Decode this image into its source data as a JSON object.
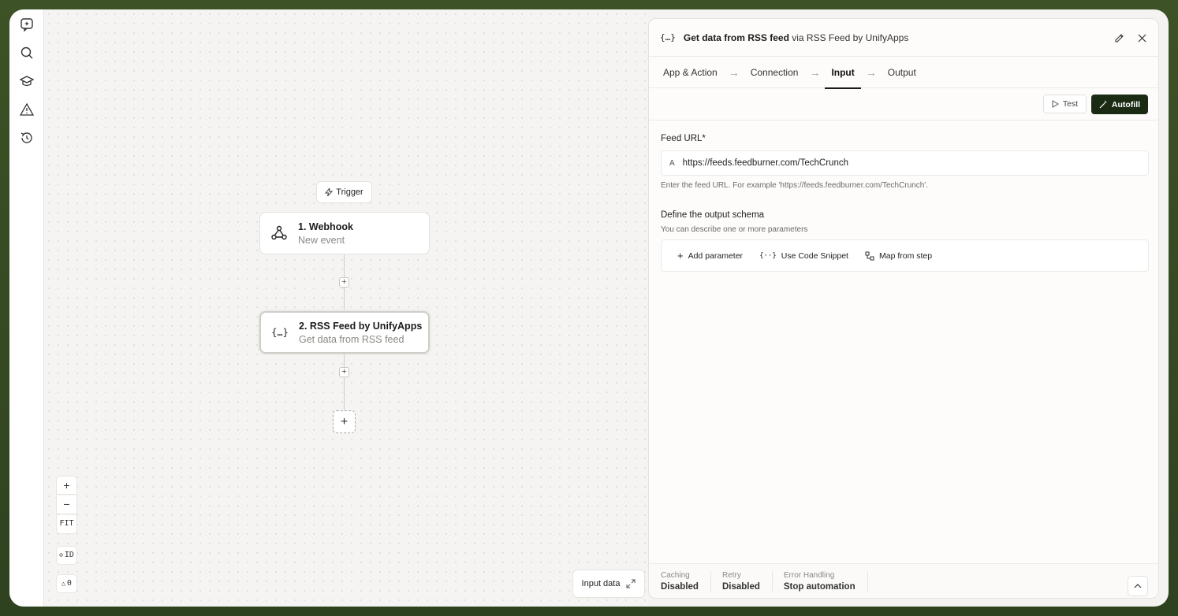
{
  "sidebar": {
    "icons": [
      "assistant-icon",
      "search-icon",
      "learn-icon",
      "alert-icon",
      "history-icon"
    ]
  },
  "canvas": {
    "trigger_label": "Trigger",
    "nodes": [
      {
        "title": "1. Webhook",
        "subtitle": "New event",
        "icon": "webhook-icon"
      },
      {
        "title": "2. RSS Feed by UnifyApps",
        "subtitle": "Get data from RSS feed",
        "icon": "{…}"
      }
    ],
    "zoom": {
      "in": "+",
      "out": "−",
      "fit": "FIT",
      "id": "ID",
      "warnings": "0"
    },
    "input_data_label": "Input data"
  },
  "panel": {
    "icon": "{…}",
    "title_bold": "Get data from RSS feed",
    "title_via": " via ",
    "title_app": "RSS Feed by UnifyApps",
    "tabs": [
      "App & Action",
      "Connection",
      "Input",
      "Output"
    ],
    "active_tab": "Input",
    "test_label": "Test",
    "autofill_label": "Autofill",
    "feed_url_label": "Feed URL*",
    "feed_url_value": "https://feeds.feedburner.com/TechCrunch",
    "feed_url_hint": "Enter the feed URL. For example 'https://feeds.feedburner.com/TechCrunch'.",
    "schema_title": "Define the output schema",
    "schema_hint": "You can describe one or more parameters",
    "schema_actions": [
      "Add parameter",
      "Use Code Snippet",
      "Map from step"
    ],
    "footer": [
      {
        "label": "Caching",
        "value": "Disabled"
      },
      {
        "label": "Retry",
        "value": "Disabled"
      },
      {
        "label": "Error Handling",
        "value": "Stop automation"
      }
    ]
  }
}
